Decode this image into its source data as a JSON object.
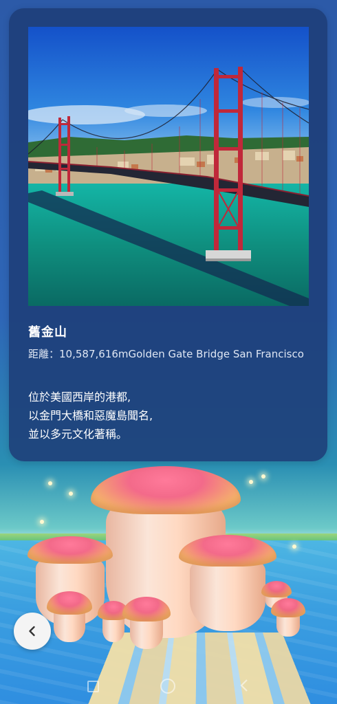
{
  "card": {
    "title": "舊金山",
    "distance": "距離：10,587,616mGolden Gate Bridge San Francisco",
    "description": "位於美國西岸的港都,\n以金門大橋和惡魔島聞名,\n並以多元文化著稱。"
  },
  "controls": {
    "back_icon": "chevron-left-icon"
  },
  "system_nav": {
    "icons": [
      "recents-icon",
      "home-icon",
      "back-icon"
    ]
  },
  "colors": {
    "card_background": "#1e3e78",
    "bridge_red": "#c0283a",
    "sky_blue": "#1f6fd8",
    "water_teal": "#1b9e94"
  }
}
